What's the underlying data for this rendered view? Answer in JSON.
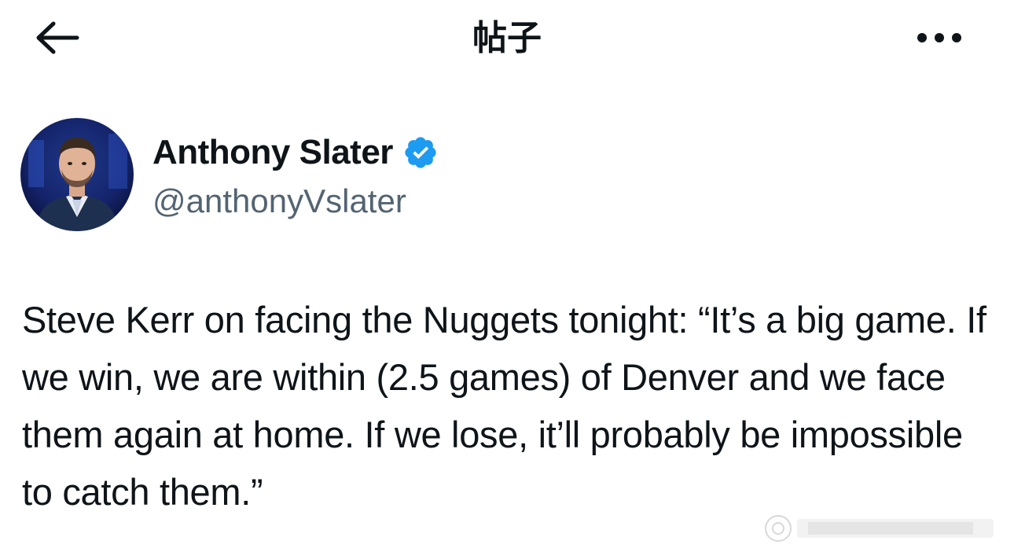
{
  "header": {
    "title": "帖子",
    "back_icon": "arrow-left-icon",
    "more_icon": "more-horizontal-icon"
  },
  "author": {
    "display_name": "Anthony Slater",
    "handle": "@anthonyVslater",
    "verified": true,
    "verified_color": "#1d9bf0"
  },
  "tweet": {
    "text": "Steve Kerr on facing the Nuggets tonight: “It’s a big game. If we win, we are within (2.5 games) of Denver and we face them again at home. If we lose, it’ll probably be impossible to catch them.”"
  },
  "colors": {
    "text_primary": "#0f1419",
    "text_secondary": "#536471",
    "background": "#ffffff"
  }
}
